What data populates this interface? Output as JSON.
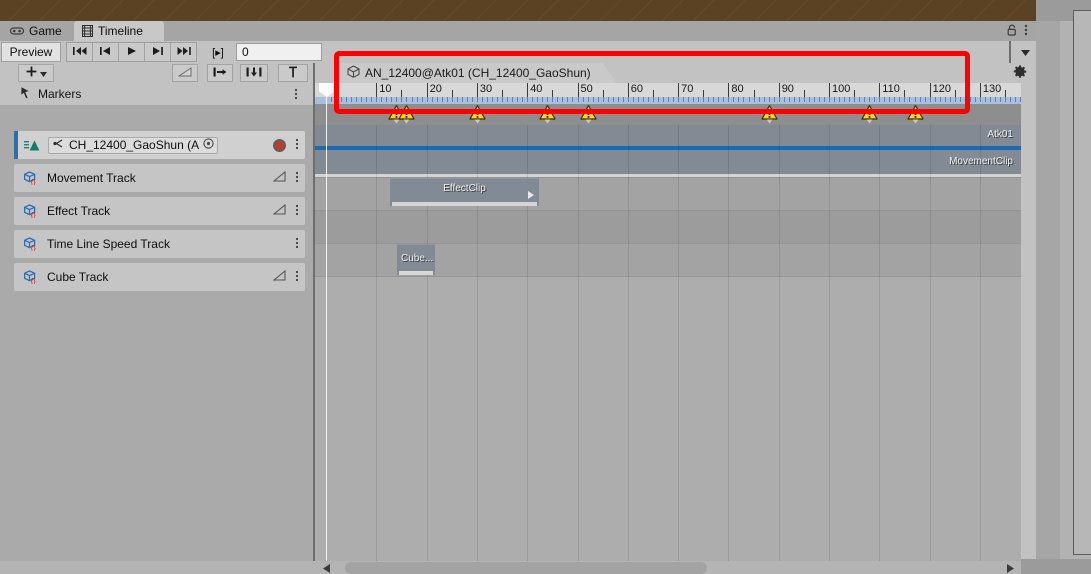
{
  "window": {
    "tabs": [
      {
        "label": "Game",
        "icon": "gamepad-icon",
        "active": false
      },
      {
        "label": "Timeline",
        "icon": "film-icon",
        "active": true
      }
    ],
    "lock_icon": "lock-icon",
    "menu_icon": "kebab-menu-icon"
  },
  "toolbar": {
    "preview_label": "Preview",
    "first_frame_label": "first-frame-icon",
    "prev_key_label": "previous-key-icon",
    "play_label": "play-icon",
    "next_key_label": "next-key-icon",
    "last_frame_label": "last-frame-icon",
    "play_range_label": "[▸]",
    "frame_value": "0",
    "frame_placeholder": "0",
    "dropdown_icon": "chevron-down-icon"
  },
  "track_tools": {
    "add_label": "+",
    "add_dropdown_icon": "chevron-down-icon",
    "curve_icon": "curves-icon",
    "mark_in_icon": "mark-in-icon",
    "mark_out_icon": "mark-out-icon",
    "pin_icon": "pin-icon"
  },
  "breadcrumb": {
    "icon": "prefab-cube-icon",
    "asset_name": "AN_12400@Atk01 (CH_12400_GaoShun)",
    "settings_icon": "gear-icon"
  },
  "markers_header": {
    "icon": "marker-pin-icon",
    "label": "Markers",
    "menu_icon": "kebab-menu-icon"
  },
  "tracks": [
    {
      "name": "CH_12400_GaoShun (A",
      "type": "animation-track",
      "icon": "animation-track-icon",
      "bound_object": "CH_12400_GaoShun (A",
      "object_picker_icon": "object-picker-icon",
      "record_icon": "record-button-icon",
      "menu_icon": "kebab-menu-icon",
      "selected": true,
      "has_curves": false
    },
    {
      "name": "Movement Track",
      "type": "playable-track",
      "icon": "playable-track-icon",
      "curves_icon": "curves-icon",
      "menu_icon": "kebab-menu-icon",
      "selected": false,
      "has_curves": true
    },
    {
      "name": "Effect Track",
      "type": "playable-track",
      "icon": "playable-track-icon",
      "curves_icon": "curves-icon",
      "menu_icon": "kebab-menu-icon",
      "selected": false,
      "has_curves": true
    },
    {
      "name": "Time Line Speed Track",
      "type": "playable-track",
      "icon": "playable-track-icon",
      "menu_icon": "kebab-menu-icon",
      "selected": false,
      "has_curves": false
    },
    {
      "name": "Cube Track",
      "type": "playable-track",
      "icon": "playable-track-icon",
      "curves_icon": "curves-icon",
      "menu_icon": "kebab-menu-icon",
      "selected": false,
      "has_curves": true
    }
  ],
  "timeline": {
    "ruler_ticks": [
      10,
      20,
      30,
      40,
      50,
      60,
      70,
      80,
      90,
      100,
      110,
      120,
      130
    ],
    "playhead_frame": "0",
    "markers": [
      {
        "frame": 14,
        "icon": "warning-marker-icon"
      },
      {
        "frame": 16,
        "icon": "warning-marker-icon"
      },
      {
        "frame": 30,
        "icon": "warning-marker-icon"
      },
      {
        "frame": 44,
        "icon": "warning-marker-icon"
      },
      {
        "frame": 52,
        "icon": "warning-marker-icon"
      },
      {
        "frame": 88,
        "icon": "warning-marker-icon"
      },
      {
        "frame": 108,
        "icon": "warning-marker-icon"
      },
      {
        "frame": 117,
        "icon": "warning-marker-icon"
      }
    ],
    "clips": [
      {
        "name": "Atk01",
        "track": "CH_12400_GaoShun (A"
      },
      {
        "name": "MovementClip",
        "track": "Movement Track"
      },
      {
        "name": "EffectClip",
        "track": "Effect Track",
        "has_blend_arrow": true
      },
      {
        "name": "Cube...",
        "track": "Cube Track"
      }
    ]
  },
  "scrollbar": {
    "left_arrow_icon": "triangle-left-icon",
    "right_arrow_icon": "triangle-right-icon"
  },
  "colors": {
    "highlight_box": "#fe0000",
    "selection_bar": "#2e6ea6",
    "record_dot": "#c0392b",
    "marker_warning": "#ffd21e",
    "clip_fill": "#818a95",
    "ruler_blue": "#a8bfe0"
  }
}
